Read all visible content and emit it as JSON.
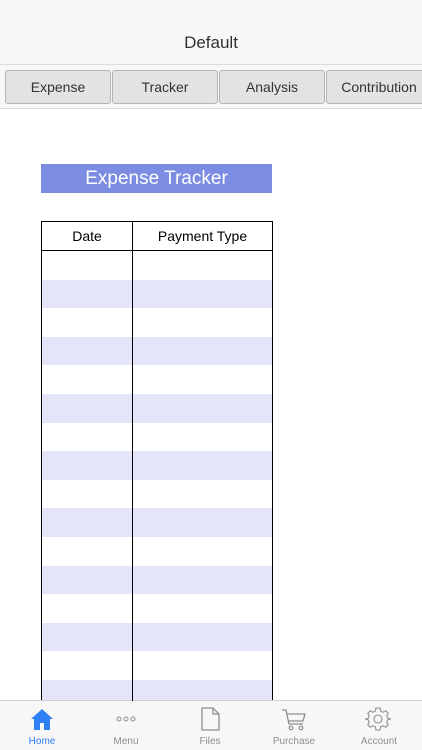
{
  "navbar": {
    "title": "Default"
  },
  "tabs": [
    {
      "label": "Expense"
    },
    {
      "label": "Tracker"
    },
    {
      "label": "Analysis"
    },
    {
      "label": "Contribution"
    }
  ],
  "sheet": {
    "title": "Expense Tracker",
    "columns": [
      "Date",
      "Payment Type"
    ],
    "row_fill_color": "#e4e5f9",
    "title_color": "#7b8ce2"
  },
  "tabbar": {
    "accent": "#2f7ff5",
    "items": [
      {
        "label": "Home",
        "icon": "home-icon",
        "active": true
      },
      {
        "label": "Menu",
        "icon": "more-dots-icon",
        "active": false
      },
      {
        "label": "Files",
        "icon": "file-icon",
        "active": false
      },
      {
        "label": "Purchase",
        "icon": "cart-icon",
        "active": false
      },
      {
        "label": "Account",
        "icon": "gear-icon",
        "active": false
      }
    ]
  }
}
